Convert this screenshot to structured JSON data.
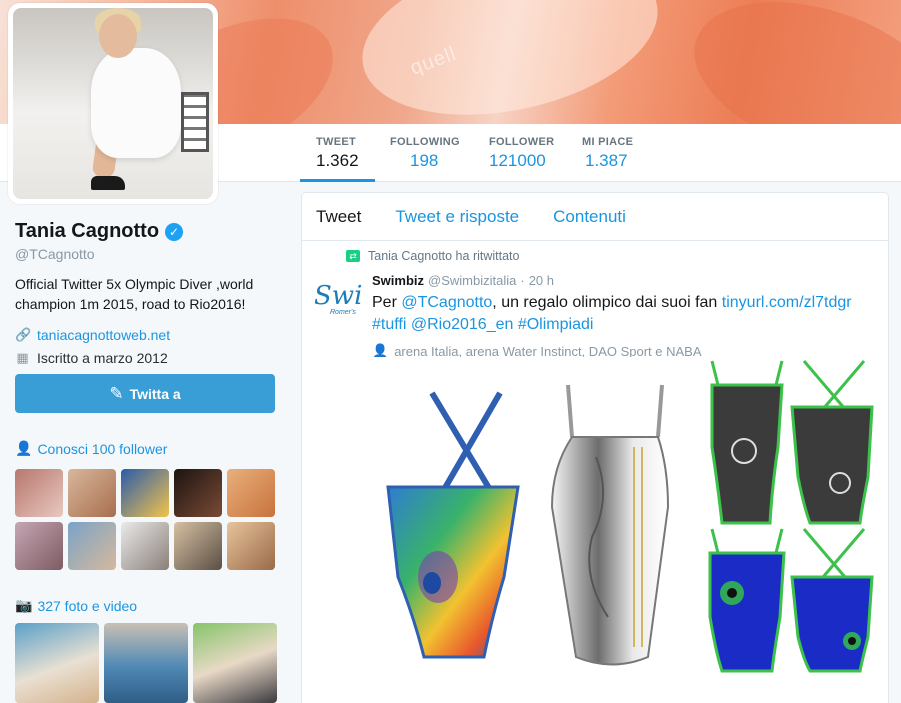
{
  "profile": {
    "name": "Tania Cagnotto",
    "handle": "@TCagnotto",
    "bio": "Official Twitter 5x Olympic Diver ,world champion 1m 2015, road to Rio2016!",
    "website": "taniacagnottoweb.net",
    "joined": "Iscritto a marzo 2012",
    "tweet_button": "Twitta a",
    "followers_you_know": "Conosci 100 follower",
    "photos_videos": "327 foto e video"
  },
  "stats": [
    {
      "label": "TWEET",
      "value": "1.362"
    },
    {
      "label": "FOLLOWING",
      "value": "198"
    },
    {
      "label": "FOLLOWER",
      "value": "121000"
    },
    {
      "label": "MI PIACE",
      "value": "1.387"
    }
  ],
  "tabs": [
    "Tweet",
    "Tweet e risposte",
    "Contenuti"
  ],
  "tweet": {
    "retweet_note": "Tania Cagnotto ha ritwittato",
    "author": "Swimbiz",
    "handle": "@Swimbizitalia",
    "separator": "·",
    "time": "20 h",
    "text_1": "Per ",
    "mention": "@TCagnotto",
    "text_2": ", un regalo olimpico dai suoi fan ",
    "link": "tinyurl.com/zl7tdgr",
    "hashtags": "#tuffi @Rio2016_en #Olimpiadi",
    "tagged": "arena Italia, arena Water Instinct, DAO Sport e NABA",
    "avatar_text": "Swi",
    "avatar_sub": "Romer's"
  },
  "banner": {
    "watermark": "quell"
  },
  "colors": {
    "accent": "#1b95e0",
    "button": "#3a9ed6",
    "retweet": "#19cf86"
  }
}
